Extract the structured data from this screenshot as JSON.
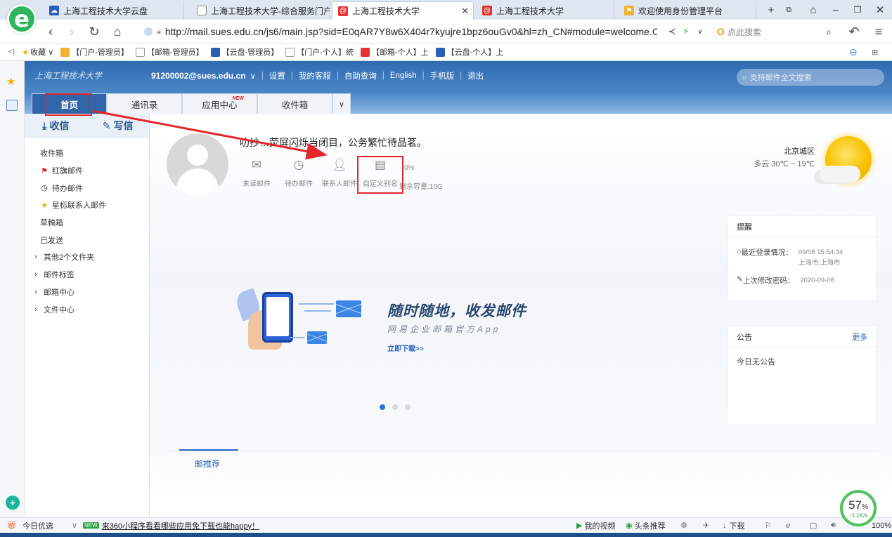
{
  "browser": {
    "tabs": [
      {
        "title": "上海工程技术大学云盘",
        "icon": "cloud-icon"
      },
      {
        "title": "上海工程技术大学-综合服务门户",
        "icon": "doc-icon"
      },
      {
        "title": "上海工程技术大学",
        "icon": "mail-icon",
        "active": true
      },
      {
        "title": "上海工程技术大学",
        "icon": "mail-icon"
      },
      {
        "title": "欢迎使用身份管理平台",
        "icon": "id-icon"
      }
    ],
    "url": "http://mail.sues.edu.cn/js6/main.jsp?sid=E0qAR7Y8w6X404r7kyujre1bpz6ouGv0&hl=zh_CN#module=welcome.Corp\\",
    "search_placeholder": "点此搜索",
    "bookmarks_label": "收藏",
    "bookmarks": [
      "【门户-管理员】",
      "【邮箱-管理员】",
      "【云盘-管理员】",
      "【门户-个人】統",
      "【邮箱-个人】上",
      "【云盘-个人】上"
    ]
  },
  "mail": {
    "account": "91200002@sues.edu.cn",
    "nav_links": [
      "设置",
      "我的客服",
      "自助查询",
      "English",
      "手机版",
      "退出"
    ],
    "search_placeholder": "支持邮件全文搜索",
    "tabs": [
      {
        "label": "首页",
        "active": true
      },
      {
        "label": "通讯录"
      },
      {
        "label": "应用中心",
        "badge": "NEW"
      },
      {
        "label": "收件箱"
      }
    ],
    "receive_label": "收信",
    "write_label": "写信",
    "folders": [
      {
        "label": "收件箱",
        "icon": ""
      },
      {
        "label": "红旗邮件",
        "icon": "red-flag-icon"
      },
      {
        "label": "待办邮件",
        "icon": "clock-icon"
      },
      {
        "label": "星标联系人邮件",
        "icon": "star-icon"
      },
      {
        "label": "草稿箱",
        "icon": ""
      },
      {
        "label": "已发送",
        "icon": ""
      }
    ],
    "expandables": [
      "其他2个文件夹",
      "邮件标签",
      "邮箱中心",
      "文件中心"
    ],
    "greeting": "叻抄…荧屏闪烁当闭目，公务繁忙待品茗。",
    "stats": [
      {
        "label": "未读邮件",
        "icon": "envelope-icon"
      },
      {
        "label": "待办邮件",
        "icon": "clock-icon"
      },
      {
        "label": "联系人邮件",
        "icon": "contact-star-icon"
      },
      {
        "label": "自定义别名",
        "icon": "id-card-icon"
      }
    ],
    "capacity_value": "0%",
    "capacity_label": "剩余容量:10G",
    "weather": {
      "city": "北京城区",
      "condition": "多云 30℃ ~ 19℃"
    },
    "remind": {
      "title": "提醒",
      "last_login_label": "最近登录情况：",
      "last_login_time": "09/08 15:54:34",
      "last_login_place": "上海市:上海市",
      "last_pwd_label": "上次修改密码：",
      "last_pwd_date": "2020-09-08"
    },
    "notice": {
      "title": "公告",
      "more": "更多",
      "empty": "今日无公告"
    },
    "banner": {
      "title": "随时随地，收发邮件",
      "subtitle": "网易企业邮箱官方App",
      "link": "立即下载>>"
    },
    "recommend_tab": "邮推荐"
  },
  "status": {
    "today": "今日优选",
    "promo_badge": "NEW",
    "promo": "来360小程序看看哪些应用免下载也能happy！",
    "video": "我的视频",
    "headline": "头条推荐",
    "download": "下载",
    "zoom": "100%"
  },
  "speed": {
    "percent": "57",
    "rate": "1.1K/s"
  },
  "colors": {
    "header_blue": "#3066a9",
    "annotation_red": "#e5262a",
    "link_blue": "#2b5fb0"
  }
}
